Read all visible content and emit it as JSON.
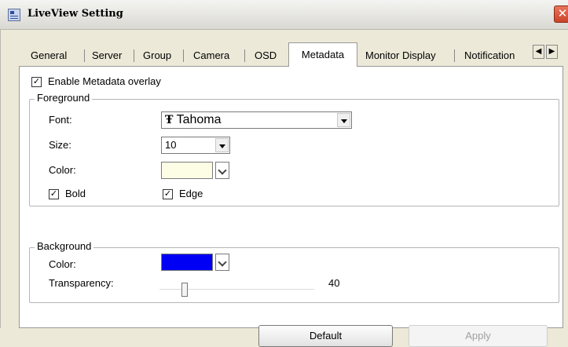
{
  "window": {
    "title": "LiveView Setting"
  },
  "tabs": [
    {
      "label": "General",
      "active": false
    },
    {
      "label": "Server",
      "active": false
    },
    {
      "label": "Group",
      "active": false
    },
    {
      "label": "Camera",
      "active": false
    },
    {
      "label": "OSD",
      "active": false
    },
    {
      "label": "Metadata",
      "active": true
    },
    {
      "label": "Monitor Display",
      "active": false
    },
    {
      "label": "Notification",
      "active": false
    }
  ],
  "metadata": {
    "enable_overlay": {
      "label": "Enable Metadata overlay",
      "checked": true
    },
    "foreground": {
      "title": "Foreground",
      "font_label": "Font:",
      "font_value": "Tahoma",
      "size_label": "Size:",
      "size_value": "10",
      "color_label": "Color:",
      "color_value": "#fdfde6",
      "bold": {
        "label": "Bold",
        "checked": true
      },
      "edge": {
        "label": "Edge",
        "checked": true
      }
    },
    "background": {
      "title": "Background",
      "color_label": "Color:",
      "color_value": "#0000f5",
      "transparency_label": "Transparency:",
      "transparency_value": "40"
    }
  },
  "buttons": {
    "default": "Default",
    "apply": "Apply"
  }
}
